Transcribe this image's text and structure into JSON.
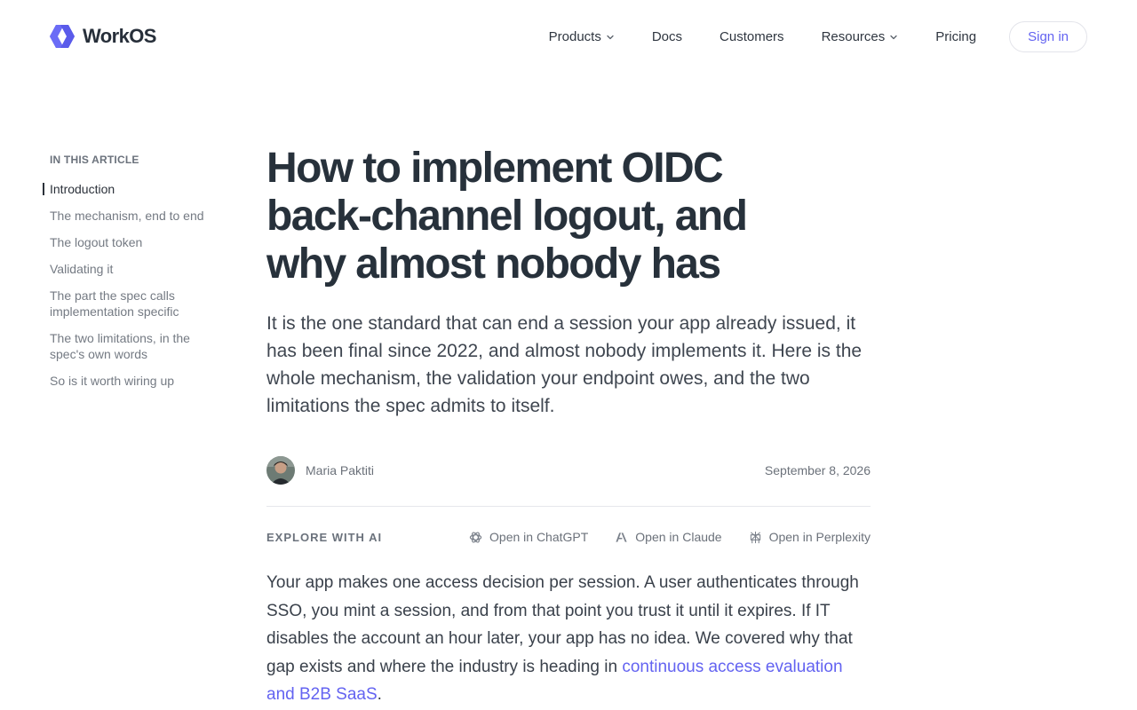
{
  "brand": {
    "name": "WorkOS",
    "accent_color": "#6363f1",
    "logo_icon": "workos-logo-icon"
  },
  "nav": {
    "items": [
      {
        "label": "Products",
        "has_dropdown": true
      },
      {
        "label": "Docs",
        "has_dropdown": false
      },
      {
        "label": "Customers",
        "has_dropdown": false
      },
      {
        "label": "Resources",
        "has_dropdown": true
      },
      {
        "label": "Pricing",
        "has_dropdown": false
      }
    ],
    "signin_label": "Sign in"
  },
  "toc": {
    "heading": "IN THIS ARTICLE",
    "items": [
      {
        "label": "Introduction",
        "active": true
      },
      {
        "label": "The mechanism, end to end",
        "active": false
      },
      {
        "label": "The logout token",
        "active": false
      },
      {
        "label": "Validating it",
        "active": false
      },
      {
        "label": "The part the spec calls implementation specific",
        "active": false
      },
      {
        "label": "The two limitations, in the spec's own words",
        "active": false
      },
      {
        "label": "So is it worth wiring up",
        "active": false
      }
    ]
  },
  "article": {
    "title": "How to implement OIDC back-channel logout, and why almost nobody has",
    "subtitle": "It is the one standard that can end a session your app already issued, it has been final since 2022, and almost nobody implements it. Here is the whole mechanism, the validation your endpoint owes, and the two limitations the spec admits to itself.",
    "author": "Maria Paktiti",
    "date": "September 8, 2026",
    "explore_label": "EXPLORE WITH AI",
    "ai_links": [
      {
        "label": "Open in ChatGPT",
        "icon": "chatgpt-icon"
      },
      {
        "label": "Open in Claude",
        "icon": "claude-icon"
      },
      {
        "label": "Open in Perplexity",
        "icon": "perplexity-icon"
      }
    ],
    "intro_text": "Your app makes one access decision per session. A user authenticates through SSO, you mint a session, and from that point you trust it until it expires. If IT disables the account an hour later, your app has no idea. We covered why that gap exists and where the industry is heading in ",
    "intro_link": "continuous access evaluation and B2B SaaS",
    "intro_end": "."
  }
}
